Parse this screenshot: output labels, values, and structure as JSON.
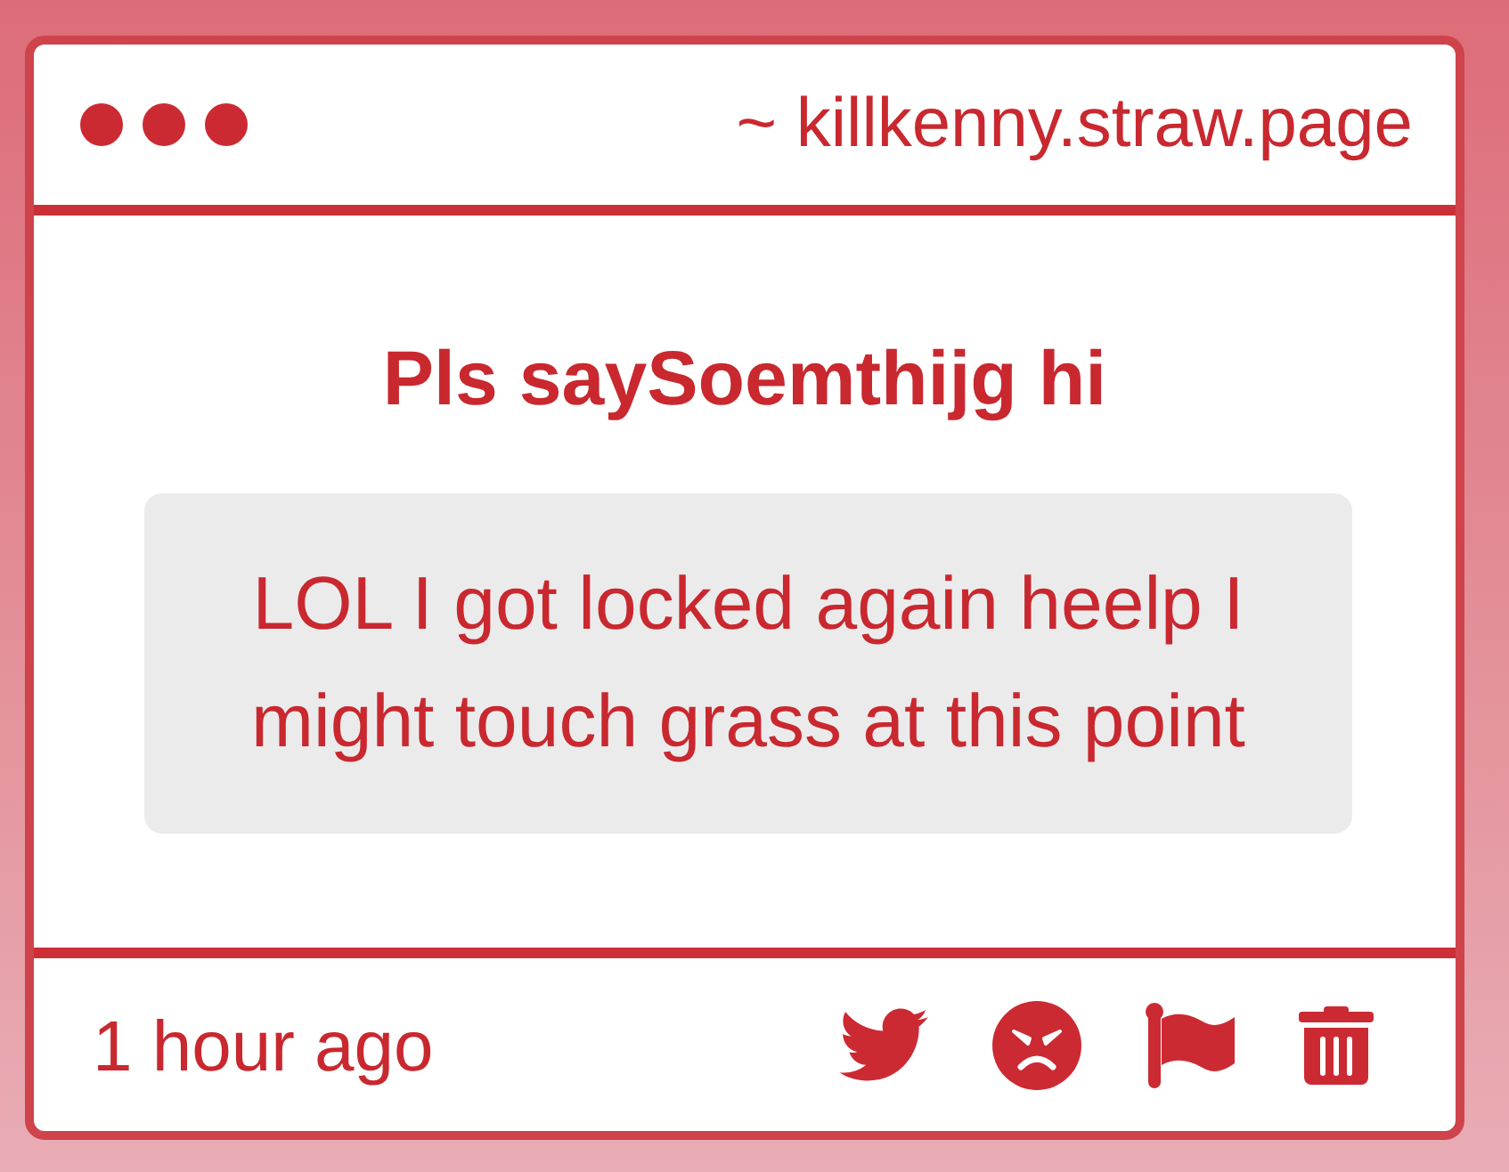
{
  "window": {
    "url": "~ killkenny.straw.page"
  },
  "post": {
    "title": "Pls saySoemthijg hi",
    "message": "LOL I got locked again heelp I might touch grass at this point"
  },
  "footer": {
    "time": "1 hour ago",
    "actions": [
      {
        "kind": "twitter"
      },
      {
        "kind": "angry"
      },
      {
        "kind": "flag"
      },
      {
        "kind": "trash"
      }
    ]
  }
}
